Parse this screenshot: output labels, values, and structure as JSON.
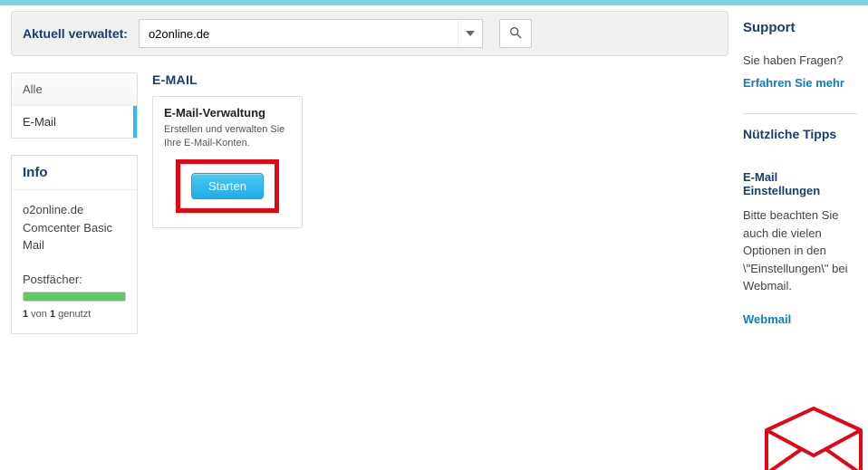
{
  "header": {
    "label": "Aktuell verwaltet:",
    "domain": "o2online.de"
  },
  "sidebar": {
    "tabs": [
      {
        "label": "Alle"
      },
      {
        "label": "E-Mail"
      }
    ]
  },
  "info": {
    "heading": "Info",
    "domain": "o2online.de",
    "plan": "Comcenter Basic Mail",
    "postfach_label": "Postfächer:",
    "usage_used": "1",
    "usage_mid": " von ",
    "usage_total": "1",
    "usage_suffix": " genutzt"
  },
  "main": {
    "section_title": "E-MAIL",
    "card": {
      "title": "E-Mail-Verwaltung",
      "desc": "Erstellen und verwalten Sie Ihre E-Mail-Konten.",
      "button": "Starten"
    }
  },
  "support": {
    "heading": "Support",
    "question": "Sie haben Fragen?",
    "link": "Erfahren Sie mehr"
  },
  "tips": {
    "heading": "Nützliche Tipps",
    "sub": "E-Mail Einstellungen",
    "text": "Bitte beachten Sie auch die vielen Optionen in den \\\"Einstellungen\\\" bei Webmail.",
    "link": "Webmail"
  }
}
